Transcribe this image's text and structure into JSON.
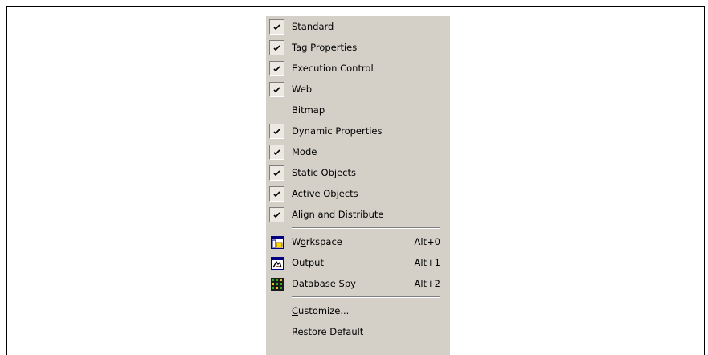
{
  "menu": {
    "toolbars": [
      {
        "label": "Standard",
        "checked": true
      },
      {
        "label": "Tag Properties",
        "checked": true
      },
      {
        "label": "Execution Control",
        "checked": true
      },
      {
        "label": "Web",
        "checked": true
      },
      {
        "label": "Bitmap",
        "checked": false
      },
      {
        "label": "Dynamic Properties",
        "checked": true
      },
      {
        "label": "Mode",
        "checked": true
      },
      {
        "label": "Static Objects",
        "checked": true
      },
      {
        "label": "Active Objects",
        "checked": true
      },
      {
        "label": "Align and Distribute",
        "checked": true
      }
    ],
    "windows": [
      {
        "label_pre": "W",
        "label_u": "o",
        "label_post": "rkspace",
        "shortcut": "Alt+0",
        "icon": "workspace-icon"
      },
      {
        "label_pre": "O",
        "label_u": "u",
        "label_post": "tput",
        "shortcut": "Alt+1",
        "icon": "output-icon"
      },
      {
        "label_pre": "",
        "label_u": "D",
        "label_post": "atabase Spy",
        "shortcut": "Alt+2",
        "icon": "database-spy-icon"
      }
    ],
    "actions": {
      "customize_u": "C",
      "customize_rest": "ustomize...",
      "restore_default": "Restore Default"
    }
  }
}
